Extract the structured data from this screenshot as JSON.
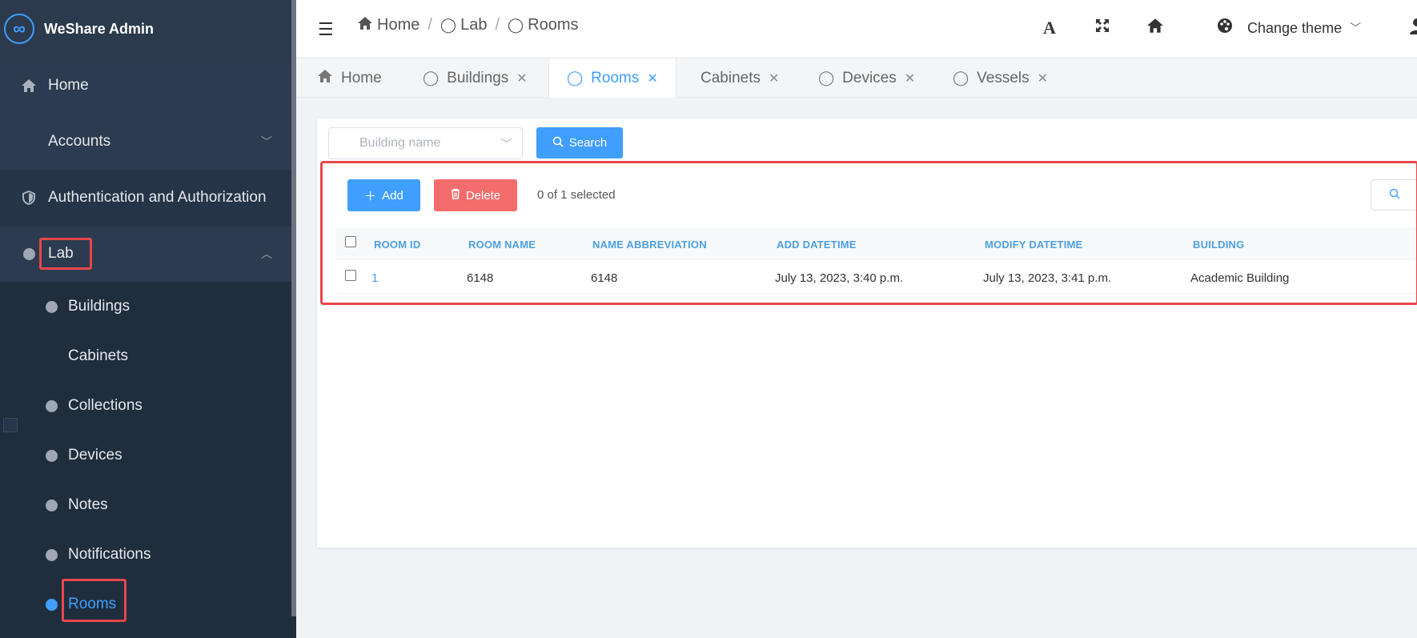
{
  "app": {
    "title": "WeShare Admin",
    "logo_glyph": "∞"
  },
  "sidebar": {
    "items": [
      {
        "label": "Home",
        "icon": "home-icon"
      },
      {
        "label": "Accounts"
      },
      {
        "label": "Authentication and Authorization",
        "icon": "shield-icon"
      },
      {
        "label": "Lab",
        "expanded": true
      },
      {
        "label": "Buildings"
      },
      {
        "label": "Cabinets"
      },
      {
        "label": "Collections"
      },
      {
        "label": "Devices"
      },
      {
        "label": "Notes"
      },
      {
        "label": "Notifications"
      },
      {
        "label": "Rooms",
        "active": true
      }
    ]
  },
  "header": {
    "breadcrumb": [
      "Home",
      "Lab",
      "Rooms"
    ],
    "theme_label": "Change theme"
  },
  "tabs": [
    {
      "label": "Home",
      "closable": false
    },
    {
      "label": "Buildings",
      "closable": true
    },
    {
      "label": "Rooms",
      "closable": true,
      "active": true
    },
    {
      "label": "Cabinets",
      "closable": true
    },
    {
      "label": "Devices",
      "closable": true
    },
    {
      "label": "Vessels",
      "closable": true
    }
  ],
  "filter": {
    "building_placeholder": "Building name",
    "search_label": "Search"
  },
  "toolbar": {
    "add_label": "Add",
    "delete_label": "Delete",
    "selected_text": "0 of 1 selected"
  },
  "table": {
    "columns": [
      "ROOM ID",
      "ROOM NAME",
      "NAME ABBREVIATION",
      "ADD DATETIME",
      "MODIFY DATETIME",
      "BUILDING"
    ],
    "rows": [
      [
        "1",
        "6148",
        "6148",
        "July 13, 2023, 3:40 p.m.",
        "July 13, 2023, 3:41 p.m.",
        "Academic Building"
      ]
    ]
  },
  "colors": {
    "accent": "#409eff",
    "danger": "#f56c6c",
    "highlight": "#e8474a",
    "sidebar_bg": "#1f2d3d"
  }
}
